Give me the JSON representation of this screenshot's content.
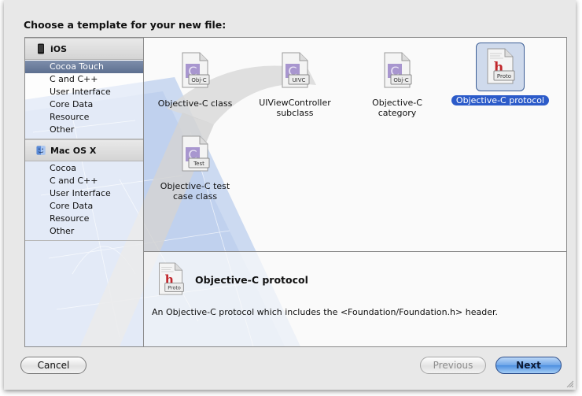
{
  "dialog": {
    "prompt": "Choose a template for your new file:"
  },
  "sidebar": {
    "groups": [
      {
        "name": "iOS",
        "icon": "iphone-icon",
        "items": [
          {
            "label": "Cocoa Touch",
            "selected": true
          },
          {
            "label": "C and C++"
          },
          {
            "label": "User Interface"
          },
          {
            "label": "Core Data"
          },
          {
            "label": "Resource"
          },
          {
            "label": "Other"
          }
        ]
      },
      {
        "name": "Mac OS X",
        "icon": "finder-icon",
        "items": [
          {
            "label": "Cocoa"
          },
          {
            "label": "C and C++"
          },
          {
            "label": "User Interface"
          },
          {
            "label": "Core Data"
          },
          {
            "label": "Resource"
          },
          {
            "label": "Other"
          }
        ]
      }
    ]
  },
  "templates": [
    {
      "label_line1": "Objective-C class",
      "label_line2": "",
      "badge": "Obj-C",
      "glyph": "C",
      "selected": false
    },
    {
      "label_line1": "UIViewController",
      "label_line2": "subclass",
      "badge": "UIVC",
      "glyph": "C",
      "selected": false
    },
    {
      "label_line1": "Objective-C",
      "label_line2": "category",
      "badge": "Obj-C",
      "glyph": "C",
      "selected": false
    },
    {
      "label_line1": "Objective-C protocol",
      "label_line2": "",
      "badge": "Proto",
      "glyph": "h",
      "selected": true
    },
    {
      "label_line1": "Objective-C test",
      "label_line2": "case class",
      "badge": "Test",
      "glyph": "C",
      "selected": false
    }
  ],
  "detail": {
    "title": "Objective-C protocol",
    "badge": "Proto",
    "glyph": "h",
    "description": "An Objective-C protocol which includes the <Foundation/Foundation.h> header."
  },
  "buttons": {
    "cancel": "Cancel",
    "previous": "Previous",
    "next": "Next"
  },
  "colors": {
    "selection": "#2c5bc9",
    "sidebar_selected": "#6a7c9c",
    "objc_purple": "#9a84c4",
    "header_red": "#c0262b"
  }
}
